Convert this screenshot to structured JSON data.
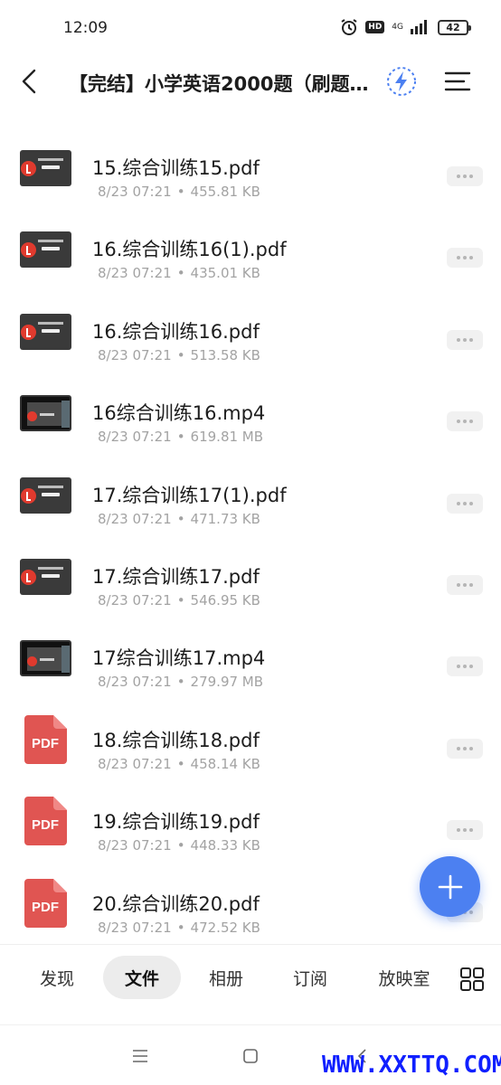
{
  "status": {
    "time": "12:09",
    "hd": "HD",
    "network": "4G",
    "battery": "42"
  },
  "header": {
    "title": "【完结】小学英语2000题（刷题…"
  },
  "files": [
    {
      "name": "15.综合训练15.pdf",
      "date": "8/23 07:21",
      "size": "455.81 KB",
      "thumb": "doc"
    },
    {
      "name": "16.综合训练16(1).pdf",
      "date": "8/23 07:21",
      "size": "435.01 KB",
      "thumb": "doc"
    },
    {
      "name": "16.综合训练16.pdf",
      "date": "8/23 07:21",
      "size": "513.58 KB",
      "thumb": "doc"
    },
    {
      "name": "16综合训练16.mp4",
      "date": "8/23 07:21",
      "size": "619.81 MB",
      "thumb": "video"
    },
    {
      "name": "17.综合训练17(1).pdf",
      "date": "8/23 07:21",
      "size": "471.73 KB",
      "thumb": "doc"
    },
    {
      "name": "17.综合训练17.pdf",
      "date": "8/23 07:21",
      "size": "546.95 KB",
      "thumb": "doc"
    },
    {
      "name": "17综合训练17.mp4",
      "date": "8/23 07:21",
      "size": "279.97 MB",
      "thumb": "video"
    },
    {
      "name": "18.综合训练18.pdf",
      "date": "8/23 07:21",
      "size": "458.14 KB",
      "thumb": "pdf"
    },
    {
      "name": "19.综合训练19.pdf",
      "date": "8/23 07:21",
      "size": "448.33 KB",
      "thumb": "pdf"
    },
    {
      "name": "20.综合训练20.pdf",
      "date": "8/23 07:21",
      "size": "472.52 KB",
      "thumb": "pdf"
    }
  ],
  "pdf_icon_label": "PDF",
  "meta_separator": "•",
  "tabs": [
    {
      "label": "发现",
      "active": false
    },
    {
      "label": "文件",
      "active": true
    },
    {
      "label": "相册",
      "active": false
    },
    {
      "label": "订阅",
      "active": false
    },
    {
      "label": "放映室",
      "active": false
    }
  ],
  "watermark": "WWW.XXTTQ.COM",
  "colors": {
    "accent": "#4c80f1",
    "pdf_red": "#e05552",
    "meta_gray": "#a3a3a3"
  },
  "icons": {
    "back": "back-arrow-icon",
    "boost": "lightning-icon",
    "menu": "menu-lines-icon",
    "more": "more-dots-icon",
    "fab": "plus-icon",
    "grid": "grid-icon",
    "nav": [
      "recents-icon",
      "home-icon",
      "back-icon"
    ]
  }
}
